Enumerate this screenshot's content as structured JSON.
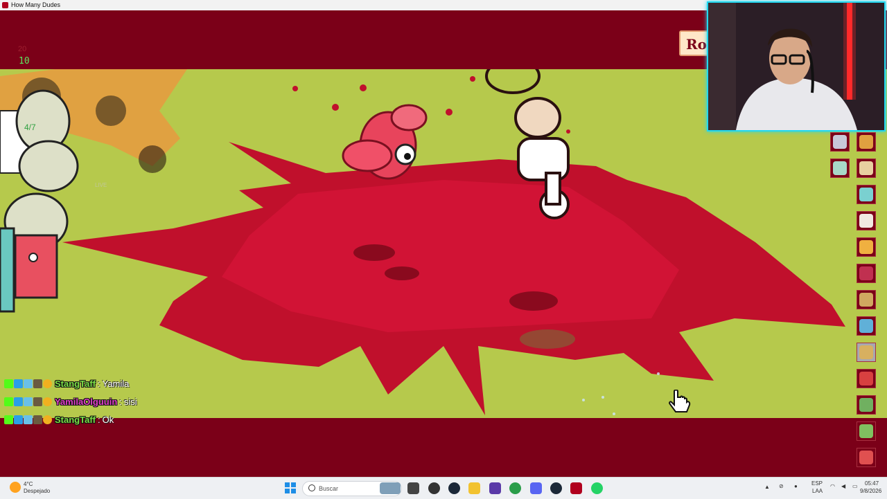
{
  "window": {
    "title": "How Many Dudes"
  },
  "hud": {
    "top_value": "20",
    "unit_count": "10"
  },
  "round_badge": {
    "label": "Ron"
  },
  "chat": [
    {
      "user": "StangTaff",
      "sep": ":",
      "message": "Yamila",
      "color": "#7be045"
    },
    {
      "user": "YamilaOlguuin",
      "sep": ":",
      "message": "sisi",
      "color": "#e040c8"
    },
    {
      "user": "StangTaff",
      "sep": ":",
      "message": "Ok",
      "color": "#7be045"
    }
  ],
  "scene": {
    "enemy_hp_label": "4/7",
    "live_tag": "LIVE"
  },
  "sidebar": {
    "items": [
      {
        "icon": "brush-icon",
        "color": "#c8c8d8"
      },
      {
        "icon": "torch-icon",
        "color": "#e0a040"
      },
      {
        "icon": "card-icon",
        "color": "#a8d8c8"
      },
      {
        "icon": "scroll-icon",
        "color": "#e8d0a0"
      },
      {
        "icon": "slingshot-icon",
        "color": "#7ad0d0"
      },
      {
        "icon": "lantern-icon",
        "color": "#f0e8e0"
      },
      {
        "icon": "wings-icon",
        "color": "#f0b040"
      },
      {
        "icon": "trap-icon",
        "color": "#c03050"
      },
      {
        "icon": "helmet-icon",
        "color": "#d0a860"
      },
      {
        "icon": "ring-icon",
        "color": "#60b0d8"
      },
      {
        "icon": "map-icon",
        "color": "#d8b060"
      },
      {
        "icon": "goblin-icon",
        "color": "#d84040"
      },
      {
        "icon": "chest-icon",
        "color": "#70b060"
      },
      {
        "icon": "sword-icon",
        "color": "#80c060"
      },
      {
        "icon": "burger-icon",
        "color": "#e05050"
      }
    ]
  },
  "taskbar": {
    "weather_temp": "4°C",
    "weather_desc": "Despejado",
    "search_placeholder": "Buscar",
    "lang": "ESP",
    "lang_sub": "LAA",
    "time": "05:47",
    "date": "9/8/2026",
    "apps": [
      {
        "name": "photos-app-icon",
        "color": "#7f9fb8"
      },
      {
        "name": "task-view-icon",
        "color": "#444"
      },
      {
        "name": "tool-app-icon",
        "color": "#333"
      },
      {
        "name": "steam-icon",
        "color": "#1b2838"
      },
      {
        "name": "file-explorer-icon",
        "color": "#f2c230"
      },
      {
        "name": "purple-app-icon",
        "color": "#5a3aa8"
      },
      {
        "name": "chrome-icon",
        "color": "#2a9d4a"
      },
      {
        "name": "discord-icon",
        "color": "#5865f2"
      },
      {
        "name": "steam-icon-2",
        "color": "#1b2838"
      },
      {
        "name": "game-app-icon",
        "color": "#b0001e"
      },
      {
        "name": "whatsapp-icon",
        "color": "#25d366"
      }
    ]
  }
}
